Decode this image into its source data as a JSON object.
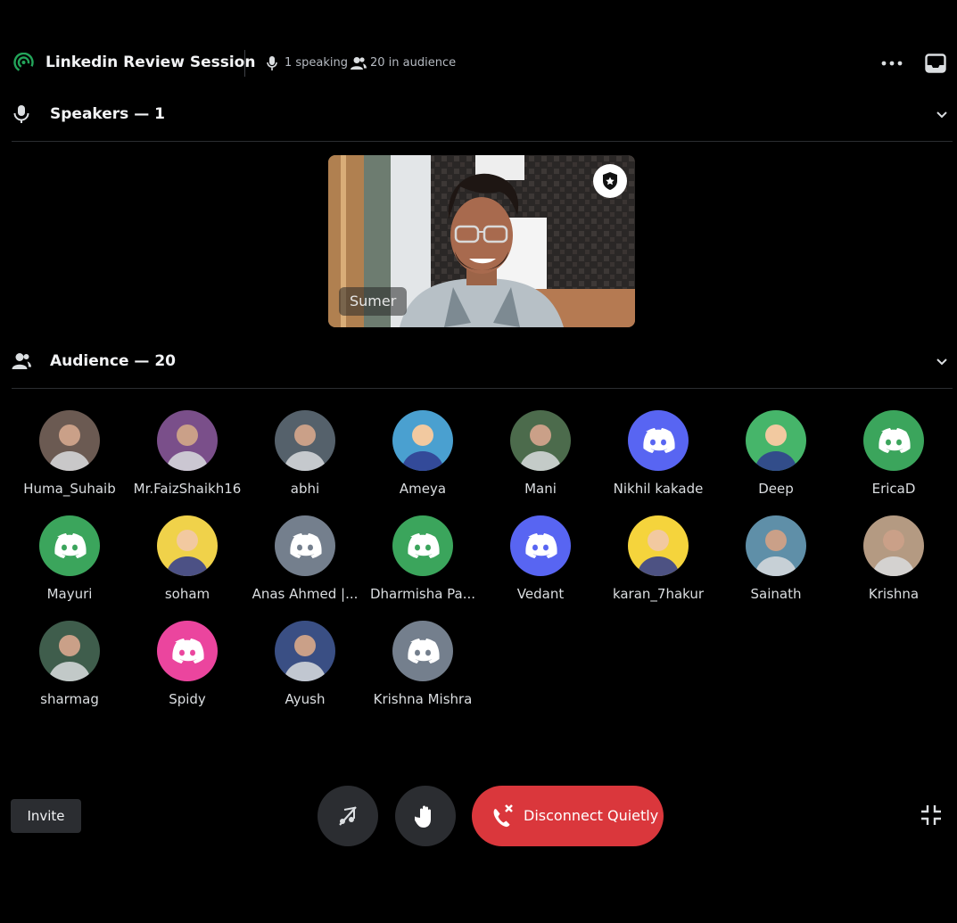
{
  "header": {
    "title": "Linkedin Review Session",
    "speaking": "1 speaking",
    "audience": "20 in audience"
  },
  "speakers": {
    "label": "Speakers — 1",
    "list": [
      {
        "name": "Sumer"
      }
    ]
  },
  "audience": {
    "label": "Audience — 20",
    "members": [
      {
        "name": "Huma_Suhaib",
        "avatar": "photo"
      },
      {
        "name": "Mr.FaizShaikh16",
        "avatar": "photo"
      },
      {
        "name": "abhi",
        "avatar": "photo"
      },
      {
        "name": "Ameya",
        "avatar": "cartoon"
      },
      {
        "name": "Mani",
        "avatar": "photo"
      },
      {
        "name": "Nikhil kakade",
        "avatar": "discord-default",
        "color": "#5865f2"
      },
      {
        "name": "Deep",
        "avatar": "cartoon"
      },
      {
        "name": "EricaD",
        "avatar": "discord-default",
        "color": "#3ba55c"
      },
      {
        "name": "Mayuri",
        "avatar": "discord-default",
        "color": "#3ba55c"
      },
      {
        "name": "soham",
        "avatar": "cartoon"
      },
      {
        "name": "Anas Ahmed |...",
        "avatar": "discord-default",
        "color": "#747f8d"
      },
      {
        "name": "Dharmisha Pa...",
        "avatar": "discord-default",
        "color": "#3ba55c"
      },
      {
        "name": "Vedant",
        "avatar": "discord-default",
        "color": "#5865f2"
      },
      {
        "name": "karan_7hakur",
        "avatar": "cartoon"
      },
      {
        "name": "Sainath",
        "avatar": "photo"
      },
      {
        "name": "Krishna",
        "avatar": "photo"
      },
      {
        "name": "sharmag",
        "avatar": "photo"
      },
      {
        "name": "Spidy",
        "avatar": "discord-default",
        "color": "#eb459e"
      },
      {
        "name": "Ayush",
        "avatar": "photo"
      },
      {
        "name": "Krishna Mishra",
        "avatar": "discord-default",
        "color": "#747f8d"
      }
    ]
  },
  "controls": {
    "invite": "Invite",
    "disconnect": "Disconnect Quietly"
  },
  "colors": {
    "accent": "#23a55a",
    "danger": "#da373c",
    "blurple": "#5865f2",
    "button_bg": "#2b2d31"
  }
}
